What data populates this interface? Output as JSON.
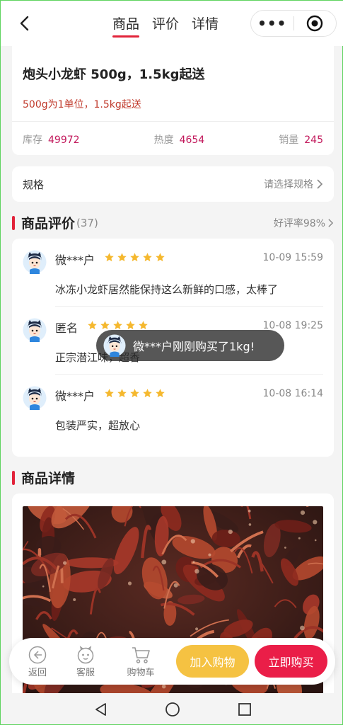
{
  "header": {
    "tabs": [
      {
        "label": "商品",
        "active": true
      },
      {
        "label": "评价",
        "active": false
      },
      {
        "label": "详情",
        "active": false
      }
    ],
    "more_glyph": "•••"
  },
  "product": {
    "title": "炮头小龙虾 500g，1.5kg起送",
    "subtitle": "500g为1单位，1.5kg起送",
    "stats": [
      {
        "label": "库存",
        "value": "49972"
      },
      {
        "label": "热度",
        "value": "4654"
      },
      {
        "label": "销量",
        "value": "245"
      }
    ]
  },
  "spec": {
    "label": "规格",
    "hint": "请选择规格"
  },
  "reviews_section": {
    "title": "商品评价",
    "count": "(37)",
    "rate": "好评率98%",
    "items": [
      {
        "name": "微***户",
        "stars": 5,
        "time": "10-09 15:59",
        "text": "冰冻小龙虾居然能保持这么新鲜的口感，太棒了"
      },
      {
        "name": "匿名",
        "stars": 5,
        "time": "10-08 19:25",
        "text": "正宗潜江味，超香"
      },
      {
        "name": "微***户",
        "stars": 5,
        "time": "10-08 16:14",
        "text": "包装严实，超放心"
      }
    ]
  },
  "toast": {
    "text": "微***户刚刚购买了1kg!"
  },
  "detail_section": {
    "title": "商品详情"
  },
  "bottom_bar": {
    "back": "返回",
    "service": "客服",
    "cart": "购物车",
    "add_to_cart": "加入购物",
    "buy_now": "立即购买"
  },
  "colors": {
    "accent_red": "#e2233a",
    "stat_value": "#c2185b",
    "subtitle_red": "#c0392b",
    "cart_yellow": "#f5c242",
    "buy_red": "#ea1e48",
    "star": "#f5b82e"
  }
}
